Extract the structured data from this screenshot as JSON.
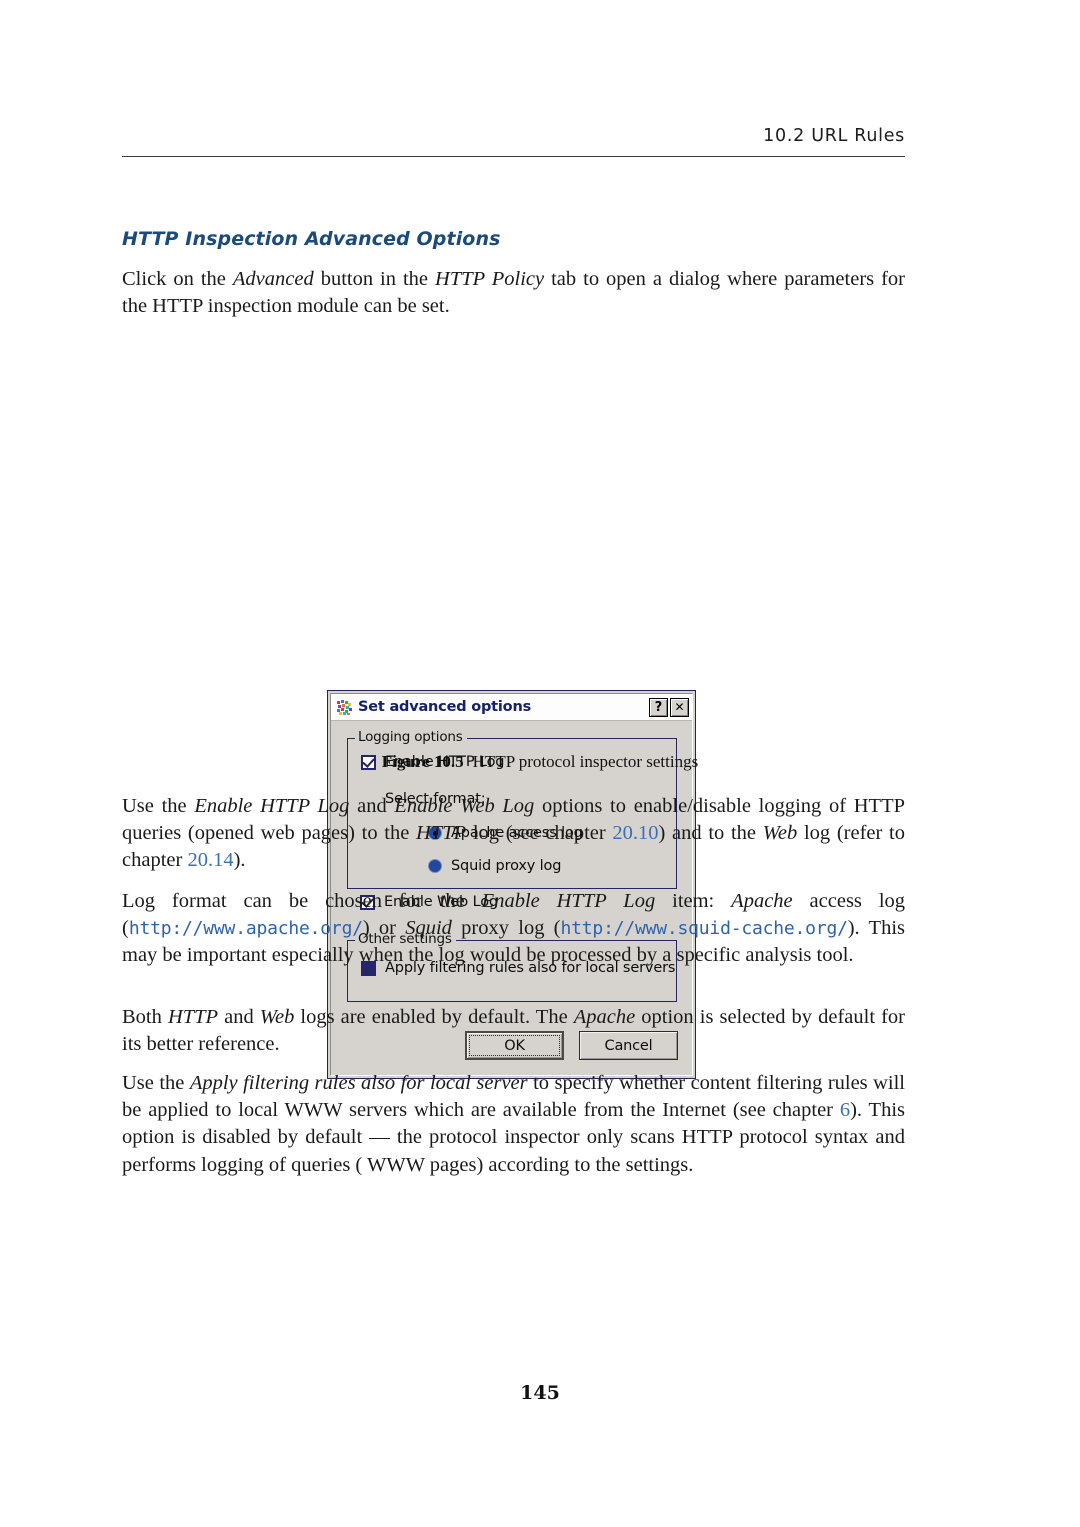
{
  "header": {
    "running_head": "10.2  URL Rules"
  },
  "section": {
    "subheading": "HTTP Inspection Advanced Options",
    "subheading_color": "#1b4a7f"
  },
  "paragraphs": {
    "intro": {
      "p1": "Click on the ",
      "em1": "Advanced",
      "p2": " button in the ",
      "em2": "HTTP Policy",
      "p3": " tab to open a dialog where parameters for the HTTP inspection module can be set."
    },
    "logs": {
      "p1": "Use the ",
      "em1": "Enable HTTP Log",
      "p2": " and ",
      "em2": "Enable Web Log",
      "p3": " options to enable/disable logging of HTTP queries (opened web pages) to the ",
      "em3": "HTTP",
      "p4": " log (see chapter ",
      "xref1": "20.10",
      "p5": ") and to the ",
      "em4": "Web",
      "p6": " log (refer to chapter ",
      "xref2": "20.14",
      "p7": ")."
    },
    "format": {
      "p1": "Log format can be chosen for the ",
      "em1": "Enable HTTP Log",
      "p2": " item: ",
      "em2": "Apache",
      "p3": " access log (",
      "url1": "http://www.apache.org/",
      "p4": ") or ",
      "em3": "Squid",
      "p5": " proxy log (",
      "url2": "http://www.squid-cache.org/",
      "p6": "). This may be important especially when the log would be processed by a specific analysis tool."
    },
    "defaults": {
      "p1": "Both ",
      "em1": "HTTP",
      "p2": " and ",
      "em2": "Web",
      "p3": " logs are enabled by default. The ",
      "em3": "Apache",
      "p4": " option is selected by default for its better reference."
    },
    "local": {
      "p1": "Use the ",
      "em1": "Apply filtering rules also for local server",
      "p2": " to specify whether content filtering rules will be applied to local WWW servers which are available from the Internet (see chapter ",
      "xref1": "6",
      "p3": "). This option is disabled by default — the protocol inspector only scans HTTP protocol syntax and performs logging of queries ( WWW pages) according to the settings."
    }
  },
  "figure": {
    "caption_label": "Figure 10.5",
    "caption_text": "HTTP protocol inspector settings"
  },
  "dialog": {
    "title": "Set advanced options",
    "help_button": "?",
    "close_button": "✕",
    "groups": {
      "logging": {
        "legend": "Logging options",
        "enable_http_log": {
          "label": "Enable HTTP Log",
          "checked": true
        },
        "select_format_label": "Select format:",
        "format_options": [
          {
            "label": "Apache access log",
            "selected": true
          },
          {
            "label": "Squid proxy log",
            "selected": false
          }
        ],
        "enable_web_log": {
          "label": "Enable Web Log",
          "checked": true
        }
      },
      "other": {
        "legend": "Other settings",
        "apply_filtering": {
          "label": "Apply filtering rules also for local servers",
          "checked": false
        }
      }
    },
    "buttons": {
      "ok": "OK",
      "cancel": "Cancel"
    }
  },
  "footer": {
    "page_number": "145"
  }
}
